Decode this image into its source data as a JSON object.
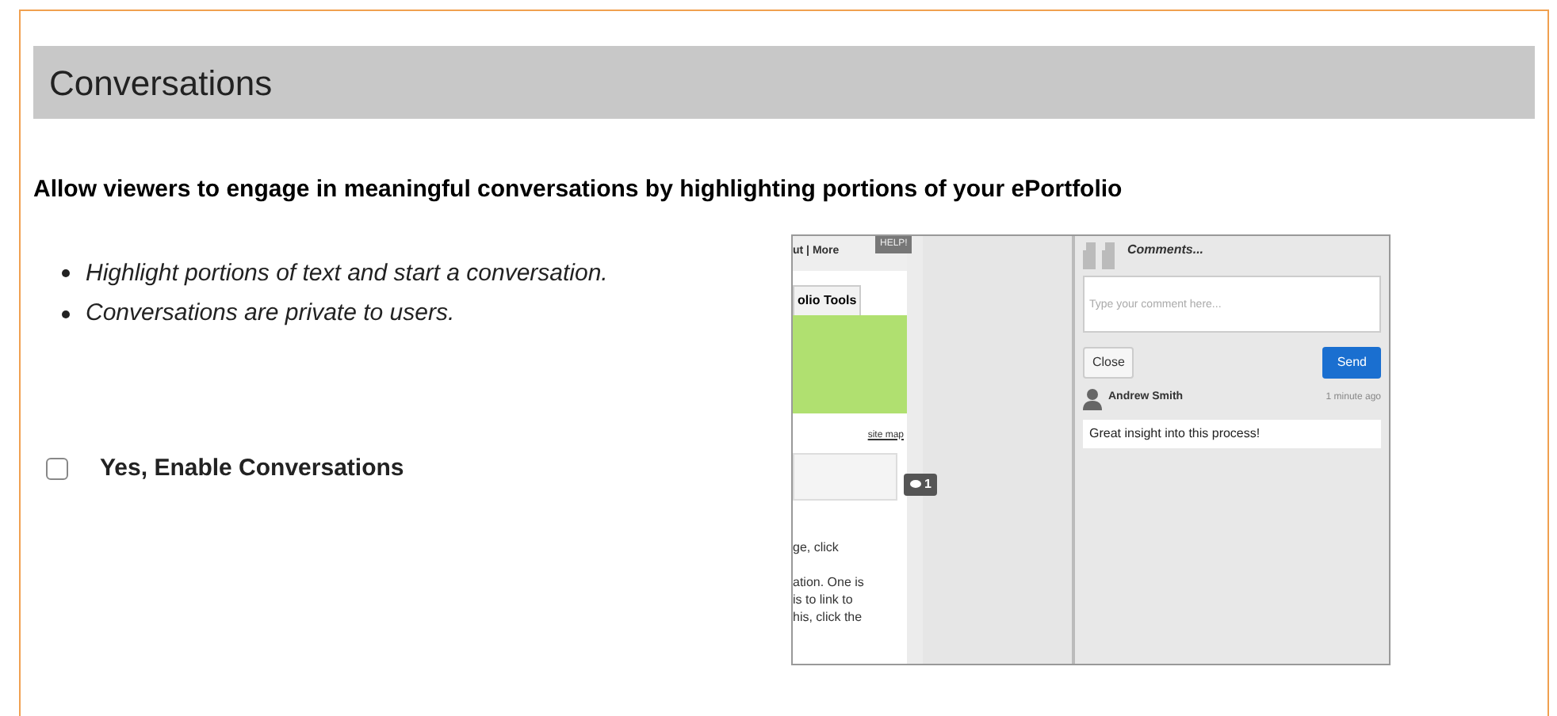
{
  "header": {
    "title": "Conversations"
  },
  "description": "Allow viewers to engage in meaningful conversations by highlighting portions of your ePortfolio",
  "bullets": [
    "Highlight portions of text and start a conversation.",
    "Conversations are private to users."
  ],
  "enable_option": {
    "label": "Yes, Enable Conversations",
    "checked": false
  },
  "preview": {
    "page": {
      "nav_links": "ut | More",
      "help_tab": "HELP!",
      "tools_tab": "olio Tools",
      "site_map": "site map",
      "comment_count": "1",
      "text_lines": [
        "ge, click",
        "ation. One is",
        "is to link to",
        "his, click the"
      ]
    },
    "comments": {
      "title": "Comments...",
      "placeholder": "Type your comment here...",
      "close_button": "Close",
      "send_button": "Send",
      "author": "Andrew Smith",
      "time": "1 minute ago",
      "comment": "Great insight into this process!"
    }
  }
}
